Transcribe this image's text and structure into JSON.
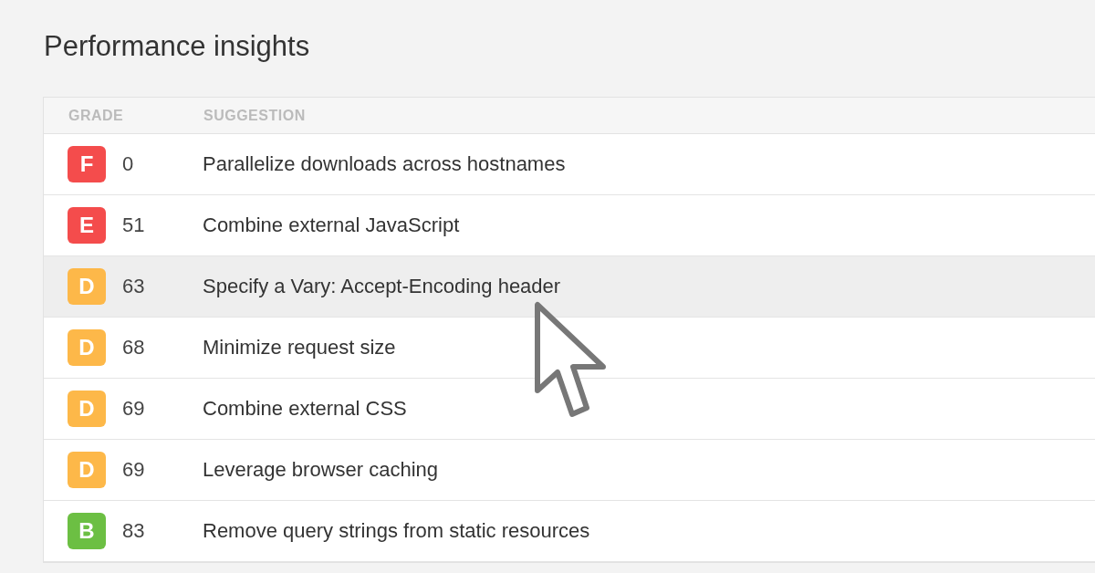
{
  "title": "Performance insights",
  "columns": [
    "GRADE",
    "SUGGESTION"
  ],
  "rows": [
    {
      "grade": "F",
      "score": "0",
      "suggestion": "Parallelize downloads across hostnames",
      "color": "#f44c4c",
      "highlighted": false
    },
    {
      "grade": "E",
      "score": "51",
      "suggestion": "Combine external JavaScript",
      "color": "#f44c4c",
      "highlighted": false
    },
    {
      "grade": "D",
      "score": "63",
      "suggestion": "Specify a Vary: Accept-Encoding header",
      "color": "#fdb849",
      "highlighted": true
    },
    {
      "grade": "D",
      "score": "68",
      "suggestion": "Minimize request size",
      "color": "#fdb849",
      "highlighted": false
    },
    {
      "grade": "D",
      "score": "69",
      "suggestion": "Combine external CSS",
      "color": "#fdb849",
      "highlighted": false
    },
    {
      "grade": "D",
      "score": "69",
      "suggestion": "Leverage browser caching",
      "color": "#fdb849",
      "highlighted": false
    },
    {
      "grade": "B",
      "score": "83",
      "suggestion": "Remove query strings from static resources",
      "color": "#6cbf43",
      "highlighted": false
    }
  ]
}
